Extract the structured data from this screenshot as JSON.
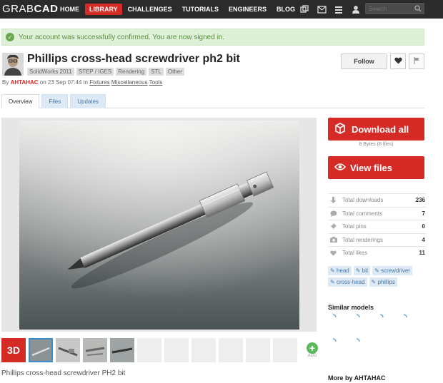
{
  "nav": {
    "logo_light": "GRAB",
    "logo_bold": "CAD",
    "items": [
      "HOME",
      "LIBRARY",
      "CHALLENGES",
      "TUTORIALS",
      "ENGINEERS",
      "BLOG"
    ],
    "active": "LIBRARY",
    "icons": [
      "windows-icon",
      "mail-icon",
      "menu-icon",
      "user-icon"
    ],
    "search_placeholder": "Search"
  },
  "alert": {
    "message": "Your account was successfully confirmed. You are now signed in."
  },
  "model": {
    "title": "Phillips cross-head screwdriver ph2 bit",
    "software_tags": [
      "SolidWorks 2011",
      "STEP / IGES",
      "Rendering",
      "STL",
      "Other"
    ],
    "by_prefix": "By",
    "author": "AHTAHAC",
    "date_text": "on 23 Sep 07:44 in",
    "categories": [
      "Fixtures",
      "Miscellaneous",
      "Tools"
    ],
    "caption": "Phillips cross-head screwdriver PH2 bit"
  },
  "actions": {
    "follow": "Follow",
    "like_icon": "heart-icon",
    "flag_icon": "flag-icon"
  },
  "tabs": [
    "Overview",
    "Files",
    "Updates"
  ],
  "active_tab": "Overview",
  "gallery": {
    "badge_3d": "3D",
    "add_label": "ADD"
  },
  "downloads": {
    "download_all": "Download all",
    "size_text": "8 Bytes (8 files)",
    "view_files": "View files"
  },
  "stats": [
    {
      "label": "Total downloads",
      "value": "236",
      "icon": "download-icon"
    },
    {
      "label": "Total comments",
      "value": "7",
      "icon": "comment-icon"
    },
    {
      "label": "Total pins",
      "value": "0",
      "icon": "pin-icon"
    },
    {
      "label": "Total renderings",
      "value": "4",
      "icon": "camera-icon"
    },
    {
      "label": "Total likes",
      "value": "11",
      "icon": "heart-icon"
    }
  ],
  "keyword_tags": [
    "head",
    "bit",
    "screwdriver",
    "cross-head",
    "phillips"
  ],
  "similar_title": "Similar models",
  "more_by": "More by AHTAHAC",
  "colors": {
    "accent": "#d52b27",
    "nav_bg": "#2b2b2b",
    "success_bg": "#dff0d8",
    "tag_bg": "#dde9f5"
  }
}
